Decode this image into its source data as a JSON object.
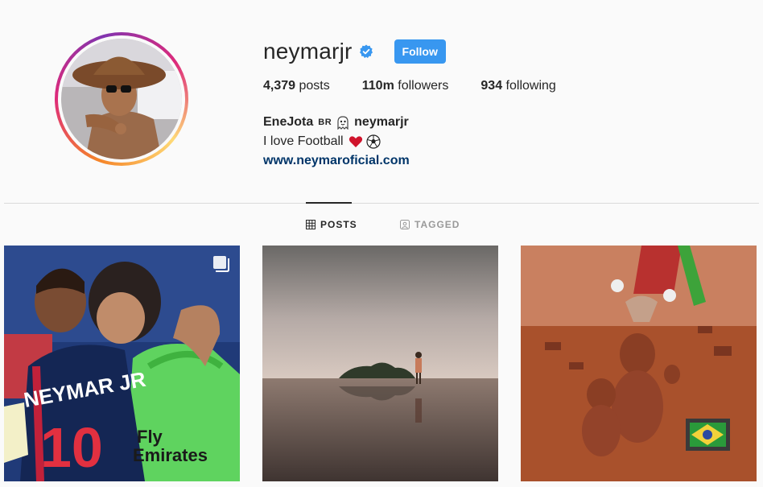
{
  "profile": {
    "username": "neymarjr",
    "follow_label": "Follow",
    "verified": true
  },
  "stats": {
    "posts_count": "4,379",
    "posts_label": "posts",
    "followers_count": "110m",
    "followers_label": "followers",
    "following_count": "934",
    "following_label": "following"
  },
  "bio": {
    "name": "EneJota",
    "flag_text": "BR",
    "handle": "neymarjr",
    "line": "I love Football",
    "line_emojis": [
      "red-heart",
      "soccer-ball"
    ],
    "link": "www.neymaroficial.com"
  },
  "tabs": [
    {
      "label": "POSTS",
      "icon": "grid-icon",
      "active": true
    },
    {
      "label": "TAGGED",
      "icon": "tag-icon",
      "active": false
    }
  ],
  "colors": {
    "follow_button": "#3897f0",
    "verified_badge": "#3897f0",
    "link": "#003569",
    "background": "#fafafa"
  }
}
